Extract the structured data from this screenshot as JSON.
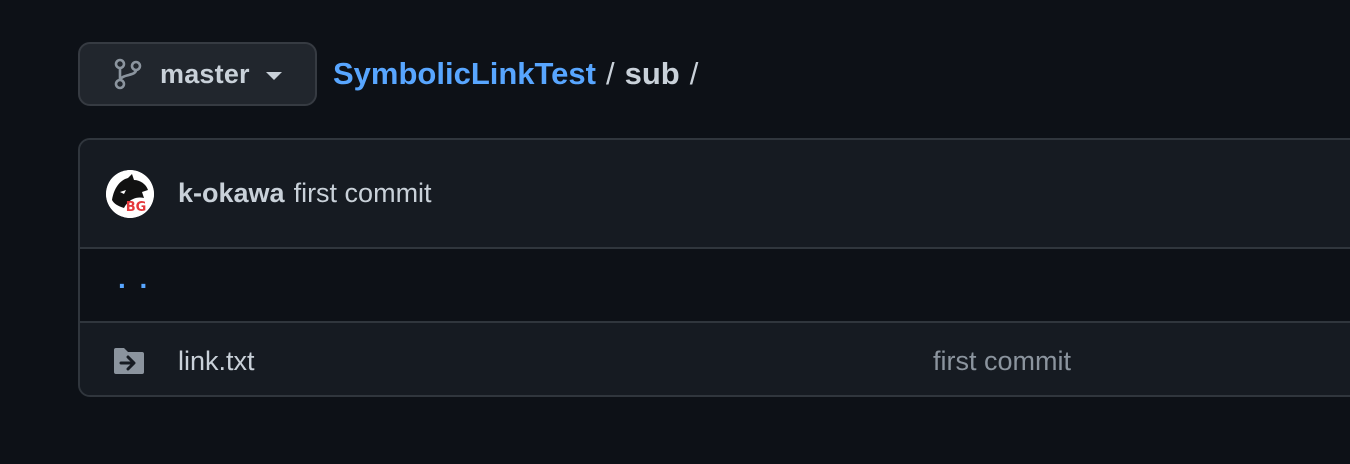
{
  "branch": {
    "name": "master",
    "icon": "git-branch-icon"
  },
  "breadcrumb": {
    "repo": "SymbolicLinkTest",
    "separator": "/",
    "dir": "sub",
    "trailing_separator": "/"
  },
  "latest_commit": {
    "author": "k-okawa",
    "message": "first commit",
    "avatar_text": "BG"
  },
  "parent_dir": {
    "label": ". ."
  },
  "files": [
    {
      "icon": "file-symlink-directory-icon",
      "name": "link.txt",
      "commit_message": "first commit"
    }
  ],
  "colors": {
    "background": "#0d1117",
    "panel": "#161b22",
    "border": "#30363d",
    "link": "#58a6ff",
    "text": "#c9d1d9",
    "muted": "#8b949e"
  }
}
